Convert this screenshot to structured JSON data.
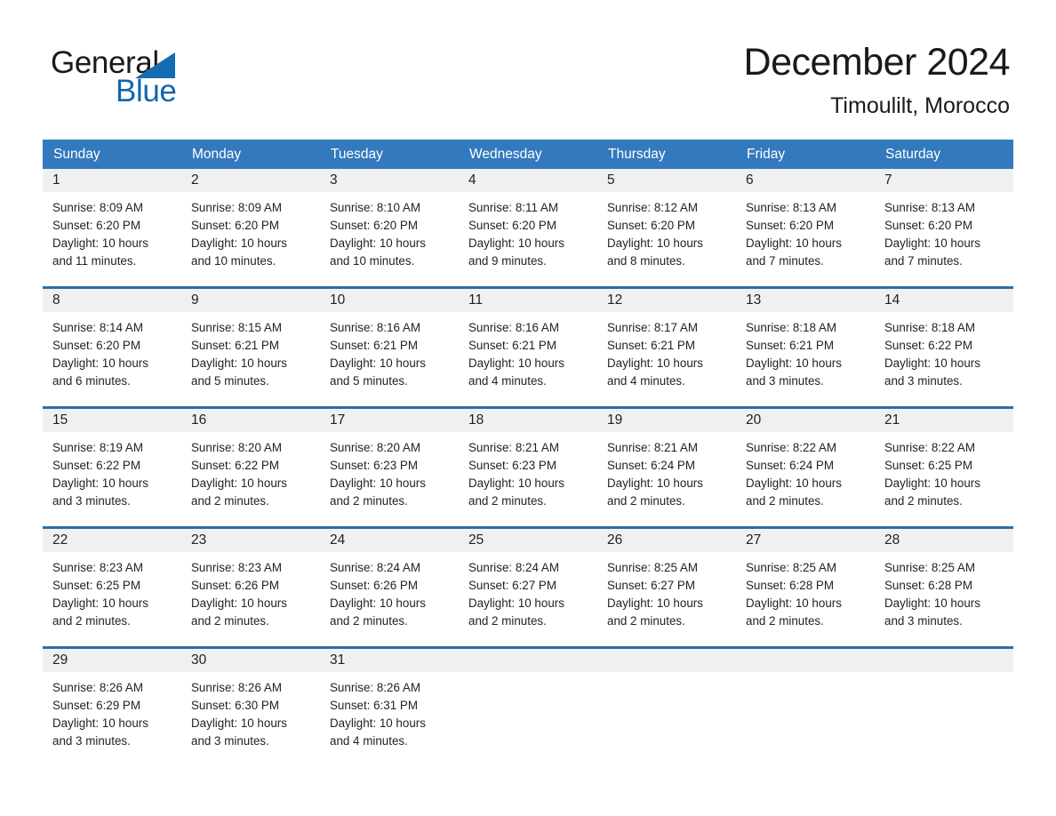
{
  "brand": {
    "word1": "General",
    "word2": "Blue",
    "triangle_color": "#136cb2",
    "blue_color": "#1266ad"
  },
  "header": {
    "title": "December 2024",
    "subtitle": "Timoulilt, Morocco"
  },
  "theme": {
    "header_row_bg": "#3379bd",
    "week_border": "#2e6da4",
    "daynum_band_bg": "#f0f0f0",
    "text": "#231f20"
  },
  "weekdays": [
    "Sunday",
    "Monday",
    "Tuesday",
    "Wednesday",
    "Thursday",
    "Friday",
    "Saturday"
  ],
  "weeks": [
    [
      {
        "day": "1",
        "sunrise": "Sunrise: 8:09 AM",
        "sunset": "Sunset: 6:20 PM",
        "daylight1": "Daylight: 10 hours",
        "daylight2": "and 11 minutes."
      },
      {
        "day": "2",
        "sunrise": "Sunrise: 8:09 AM",
        "sunset": "Sunset: 6:20 PM",
        "daylight1": "Daylight: 10 hours",
        "daylight2": "and 10 minutes."
      },
      {
        "day": "3",
        "sunrise": "Sunrise: 8:10 AM",
        "sunset": "Sunset: 6:20 PM",
        "daylight1": "Daylight: 10 hours",
        "daylight2": "and 10 minutes."
      },
      {
        "day": "4",
        "sunrise": "Sunrise: 8:11 AM",
        "sunset": "Sunset: 6:20 PM",
        "daylight1": "Daylight: 10 hours",
        "daylight2": "and 9 minutes."
      },
      {
        "day": "5",
        "sunrise": "Sunrise: 8:12 AM",
        "sunset": "Sunset: 6:20 PM",
        "daylight1": "Daylight: 10 hours",
        "daylight2": "and 8 minutes."
      },
      {
        "day": "6",
        "sunrise": "Sunrise: 8:13 AM",
        "sunset": "Sunset: 6:20 PM",
        "daylight1": "Daylight: 10 hours",
        "daylight2": "and 7 minutes."
      },
      {
        "day": "7",
        "sunrise": "Sunrise: 8:13 AM",
        "sunset": "Sunset: 6:20 PM",
        "daylight1": "Daylight: 10 hours",
        "daylight2": "and 7 minutes."
      }
    ],
    [
      {
        "day": "8",
        "sunrise": "Sunrise: 8:14 AM",
        "sunset": "Sunset: 6:20 PM",
        "daylight1": "Daylight: 10 hours",
        "daylight2": "and 6 minutes."
      },
      {
        "day": "9",
        "sunrise": "Sunrise: 8:15 AM",
        "sunset": "Sunset: 6:21 PM",
        "daylight1": "Daylight: 10 hours",
        "daylight2": "and 5 minutes."
      },
      {
        "day": "10",
        "sunrise": "Sunrise: 8:16 AM",
        "sunset": "Sunset: 6:21 PM",
        "daylight1": "Daylight: 10 hours",
        "daylight2": "and 5 minutes."
      },
      {
        "day": "11",
        "sunrise": "Sunrise: 8:16 AM",
        "sunset": "Sunset: 6:21 PM",
        "daylight1": "Daylight: 10 hours",
        "daylight2": "and 4 minutes."
      },
      {
        "day": "12",
        "sunrise": "Sunrise: 8:17 AM",
        "sunset": "Sunset: 6:21 PM",
        "daylight1": "Daylight: 10 hours",
        "daylight2": "and 4 minutes."
      },
      {
        "day": "13",
        "sunrise": "Sunrise: 8:18 AM",
        "sunset": "Sunset: 6:21 PM",
        "daylight1": "Daylight: 10 hours",
        "daylight2": "and 3 minutes."
      },
      {
        "day": "14",
        "sunrise": "Sunrise: 8:18 AM",
        "sunset": "Sunset: 6:22 PM",
        "daylight1": "Daylight: 10 hours",
        "daylight2": "and 3 minutes."
      }
    ],
    [
      {
        "day": "15",
        "sunrise": "Sunrise: 8:19 AM",
        "sunset": "Sunset: 6:22 PM",
        "daylight1": "Daylight: 10 hours",
        "daylight2": "and 3 minutes."
      },
      {
        "day": "16",
        "sunrise": "Sunrise: 8:20 AM",
        "sunset": "Sunset: 6:22 PM",
        "daylight1": "Daylight: 10 hours",
        "daylight2": "and 2 minutes."
      },
      {
        "day": "17",
        "sunrise": "Sunrise: 8:20 AM",
        "sunset": "Sunset: 6:23 PM",
        "daylight1": "Daylight: 10 hours",
        "daylight2": "and 2 minutes."
      },
      {
        "day": "18",
        "sunrise": "Sunrise: 8:21 AM",
        "sunset": "Sunset: 6:23 PM",
        "daylight1": "Daylight: 10 hours",
        "daylight2": "and 2 minutes."
      },
      {
        "day": "19",
        "sunrise": "Sunrise: 8:21 AM",
        "sunset": "Sunset: 6:24 PM",
        "daylight1": "Daylight: 10 hours",
        "daylight2": "and 2 minutes."
      },
      {
        "day": "20",
        "sunrise": "Sunrise: 8:22 AM",
        "sunset": "Sunset: 6:24 PM",
        "daylight1": "Daylight: 10 hours",
        "daylight2": "and 2 minutes."
      },
      {
        "day": "21",
        "sunrise": "Sunrise: 8:22 AM",
        "sunset": "Sunset: 6:25 PM",
        "daylight1": "Daylight: 10 hours",
        "daylight2": "and 2 minutes."
      }
    ],
    [
      {
        "day": "22",
        "sunrise": "Sunrise: 8:23 AM",
        "sunset": "Sunset: 6:25 PM",
        "daylight1": "Daylight: 10 hours",
        "daylight2": "and 2 minutes."
      },
      {
        "day": "23",
        "sunrise": "Sunrise: 8:23 AM",
        "sunset": "Sunset: 6:26 PM",
        "daylight1": "Daylight: 10 hours",
        "daylight2": "and 2 minutes."
      },
      {
        "day": "24",
        "sunrise": "Sunrise: 8:24 AM",
        "sunset": "Sunset: 6:26 PM",
        "daylight1": "Daylight: 10 hours",
        "daylight2": "and 2 minutes."
      },
      {
        "day": "25",
        "sunrise": "Sunrise: 8:24 AM",
        "sunset": "Sunset: 6:27 PM",
        "daylight1": "Daylight: 10 hours",
        "daylight2": "and 2 minutes."
      },
      {
        "day": "26",
        "sunrise": "Sunrise: 8:25 AM",
        "sunset": "Sunset: 6:27 PM",
        "daylight1": "Daylight: 10 hours",
        "daylight2": "and 2 minutes."
      },
      {
        "day": "27",
        "sunrise": "Sunrise: 8:25 AM",
        "sunset": "Sunset: 6:28 PM",
        "daylight1": "Daylight: 10 hours",
        "daylight2": "and 2 minutes."
      },
      {
        "day": "28",
        "sunrise": "Sunrise: 8:25 AM",
        "sunset": "Sunset: 6:28 PM",
        "daylight1": "Daylight: 10 hours",
        "daylight2": "and 3 minutes."
      }
    ],
    [
      {
        "day": "29",
        "sunrise": "Sunrise: 8:26 AM",
        "sunset": "Sunset: 6:29 PM",
        "daylight1": "Daylight: 10 hours",
        "daylight2": "and 3 minutes."
      },
      {
        "day": "30",
        "sunrise": "Sunrise: 8:26 AM",
        "sunset": "Sunset: 6:30 PM",
        "daylight1": "Daylight: 10 hours",
        "daylight2": "and 3 minutes."
      },
      {
        "day": "31",
        "sunrise": "Sunrise: 8:26 AM",
        "sunset": "Sunset: 6:31 PM",
        "daylight1": "Daylight: 10 hours",
        "daylight2": "and 4 minutes."
      },
      {
        "day": "",
        "sunrise": "",
        "sunset": "",
        "daylight1": "",
        "daylight2": ""
      },
      {
        "day": "",
        "sunrise": "",
        "sunset": "",
        "daylight1": "",
        "daylight2": ""
      },
      {
        "day": "",
        "sunrise": "",
        "sunset": "",
        "daylight1": "",
        "daylight2": ""
      },
      {
        "day": "",
        "sunrise": "",
        "sunset": "",
        "daylight1": "",
        "daylight2": ""
      }
    ]
  ]
}
